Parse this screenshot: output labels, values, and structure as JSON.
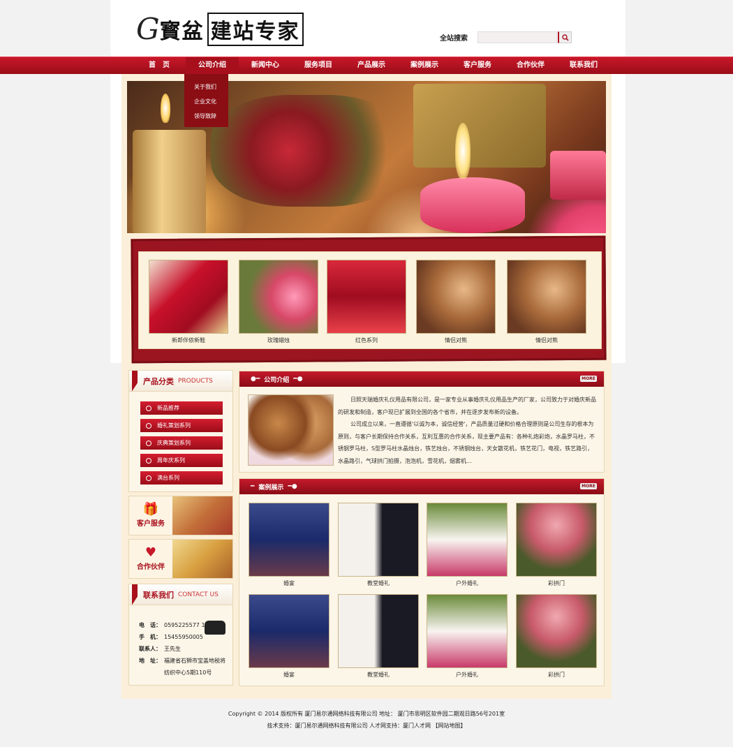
{
  "header": {
    "logo_g": "G",
    "logo_brush": "寳盆",
    "logo_text": "建站专家",
    "search_label": "全站搜索",
    "search_placeholder": "",
    "search_icon": "magnifier-icon"
  },
  "nav": {
    "items": [
      "首　页",
      "公司介绍",
      "新闻中心",
      "服务项目",
      "产品展示",
      "案例展示",
      "客户服务",
      "合作伙伴",
      "联系我们"
    ],
    "dropdown": [
      "关于我们",
      "企业文化",
      "领导致辞"
    ]
  },
  "gallery": {
    "items": [
      "新郎伴侬新鞋",
      "玫瑰蜡烛",
      "红色系列",
      "情侣对熊",
      "情侣对熊"
    ]
  },
  "sidebar": {
    "categories": {
      "title": "产品分类",
      "title_en": "PRODUCTS",
      "items": [
        "新品推荐",
        "婚礼策划系列",
        "庆典策划系列",
        "周年庆系列",
        "满台系列"
      ]
    },
    "customer_service": "客户服务",
    "partners": "合作伙伴",
    "contact": {
      "title": "联系我们",
      "title_en": "CONTACT US",
      "rows": [
        {
          "k": "电　话：",
          "v": "0595225577 16"
        },
        {
          "k": "手　机：",
          "v": "15455950005"
        },
        {
          "k": "联系人：",
          "v": "王先生"
        },
        {
          "k": "地　址：",
          "v": "福建省石狮市宝盖地税将"
        }
      ],
      "address_line2": "纺织中心5期110号"
    }
  },
  "about": {
    "title": "公司介绍",
    "more": "MORE",
    "paragraph1": "日照天瑞婚庆礼仪用品有限公司，是一家专业从事婚庆礼仪用品生产的厂家，公司致力于对婚庆新品的研发和制造，客户现已扩展到全国的各个省市，并在逐步发布新的设备。",
    "paragraph2": "公司成立以来，一直遵循'以诚为本，诚信经营'，产品质量过硬和价格合理原则是公司生存的根本为原则，与客户长期保持合作关系，互利互惠的合作关系，现主要产品有：各种礼炮彩炮，水晶罗马柱，不锈钢罗马柱，S型罗马柱水晶烛台，铁艺烛台，不锈钢烛台，天女散花机，铁艺花门，电视，铁艺路引，水晶路引，气球拱门拍摄，泡泡机，雪花机，烟雾机..."
  },
  "cases": {
    "title": "案例展示",
    "more": "MORE",
    "items": [
      "婚宴",
      "教堂婚礼",
      "户外婚礼",
      "彩拱门",
      "婚宴",
      "教堂婚礼",
      "户外婚礼",
      "彩拱门"
    ]
  },
  "footer": {
    "line1": "Copyright © 2014 版权所有  厦门易尔通网络科技有限公司  地址：  厦门市思明区软件园二期观日路56号201室",
    "line2": "技术支持：厦门易尔通网络科技有限公司  人才网支持：厦门人才网  【网站地图】"
  },
  "colors": {
    "brand_red": "#b01020",
    "frame_cream": "#fbefd9"
  }
}
